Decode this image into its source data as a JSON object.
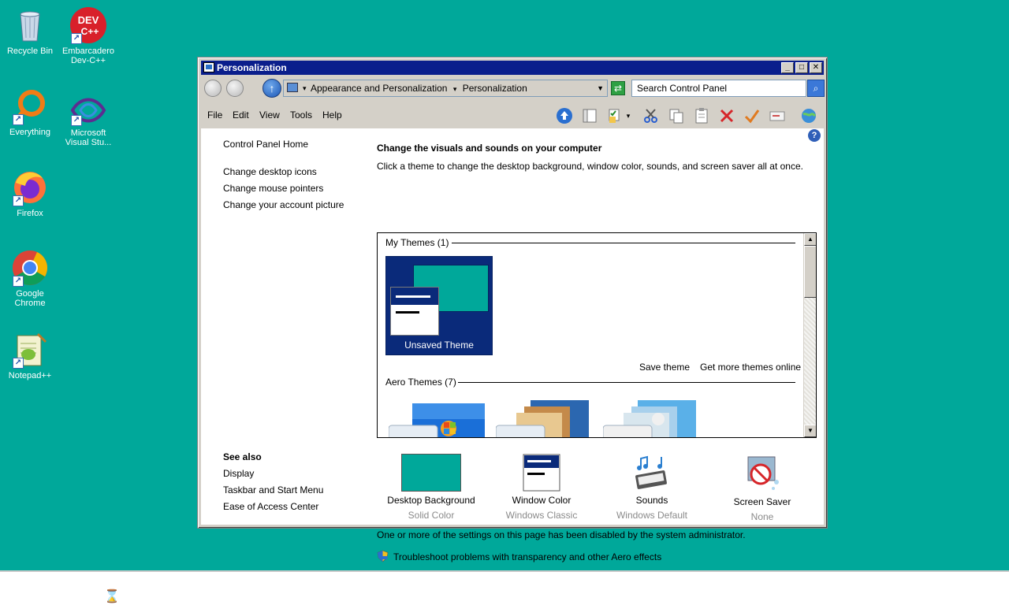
{
  "colors": {
    "desktop": "#00a89a",
    "titlebar": "#0a1e8c",
    "theme_tile": "#0a2a7a"
  },
  "desktop": {
    "icons": [
      {
        "label": "Recycle Bin",
        "icon": "recycle-bin-icon"
      },
      {
        "label": "Embarcadero Dev-C++",
        "icon": "devcpp-icon",
        "badge": "DEV C++"
      },
      {
        "label": "Everything",
        "icon": "everything-icon"
      },
      {
        "label": "Microsoft Visual Stu...",
        "icon": "visual-studio-icon"
      },
      {
        "label": "Firefox",
        "icon": "firefox-icon"
      },
      {
        "label": "Google Chrome",
        "icon": "chrome-icon"
      },
      {
        "label": "Notepad++",
        "icon": "notepadpp-icon"
      }
    ]
  },
  "window": {
    "title": "Personalization",
    "address": {
      "crumbs": [
        "Appearance and Personalization",
        "Personalization"
      ]
    },
    "search": {
      "placeholder": "Search Control Panel"
    },
    "menu": [
      "File",
      "Edit",
      "View",
      "Tools",
      "Help"
    ],
    "sidebar": {
      "home": "Control Panel Home",
      "links": [
        "Change desktop icons",
        "Change mouse pointers",
        "Change your account picture"
      ],
      "see_also_title": "See also",
      "see_also": [
        "Display",
        "Taskbar and Start Menu",
        "Ease of Access Center"
      ]
    },
    "main": {
      "heading": "Change the visuals and sounds on your computer",
      "description": "Click a theme to change the desktop background, window color, sounds, and screen saver all at once.",
      "my_themes_label": "My Themes (1)",
      "unsaved_theme": "Unsaved Theme",
      "save_theme": "Save theme",
      "get_more": "Get more themes online",
      "aero_themes_label": "Aero Themes (7)",
      "settings": [
        {
          "name": "Desktop Background",
          "value": "Solid Color",
          "icon": "desktop-background-icon"
        },
        {
          "name": "Window Color",
          "value": "Windows Classic",
          "icon": "window-color-icon"
        },
        {
          "name": "Sounds",
          "value": "Windows Default",
          "icon": "sounds-icon"
        },
        {
          "name": "Screen Saver",
          "value": "None",
          "icon": "screen-saver-icon"
        }
      ],
      "disabled_notice": "One or more of the settings on this page has been disabled by the system administrator.",
      "troubleshoot": "Troubleshoot problems with transparency and other Aero effects"
    }
  }
}
